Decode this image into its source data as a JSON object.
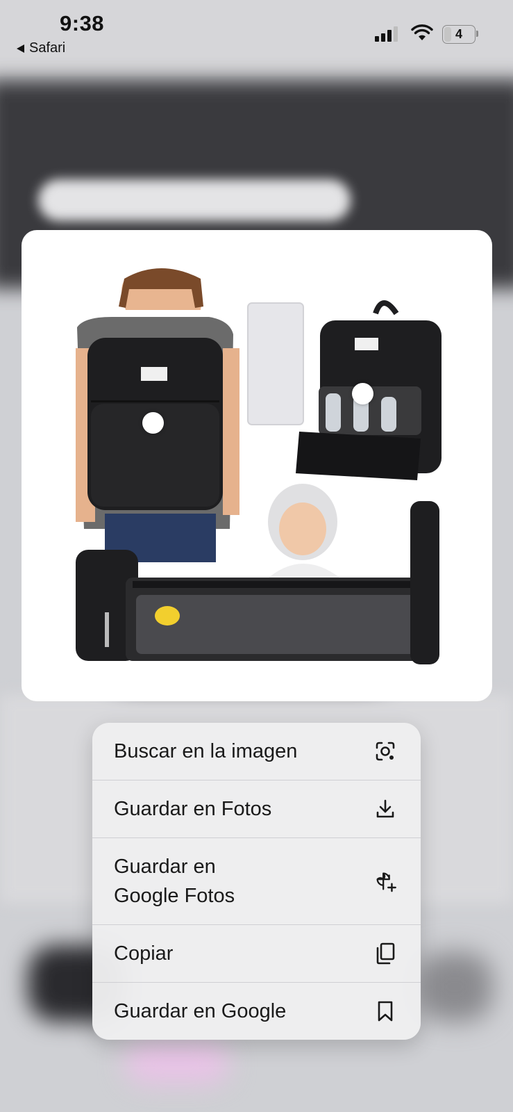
{
  "status_bar": {
    "time": "9:38",
    "back_app": "Safari",
    "battery_level": "4"
  },
  "context_menu": {
    "items": [
      {
        "label": "Buscar en la imagen",
        "icon": "lens-search-icon"
      },
      {
        "label": "Guardar en Fotos",
        "icon": "download-icon"
      },
      {
        "label": "Guardar en\nGoogle Fotos",
        "icon": "google-photos-add-icon"
      },
      {
        "label": "Copiar",
        "icon": "copy-icon"
      },
      {
        "label": "Guardar en Google",
        "icon": "bookmark-icon"
      }
    ]
  },
  "colors": {
    "bag": "#1e1e20",
    "menu_background": "#eeeef0",
    "text": "#1a1a1a"
  }
}
